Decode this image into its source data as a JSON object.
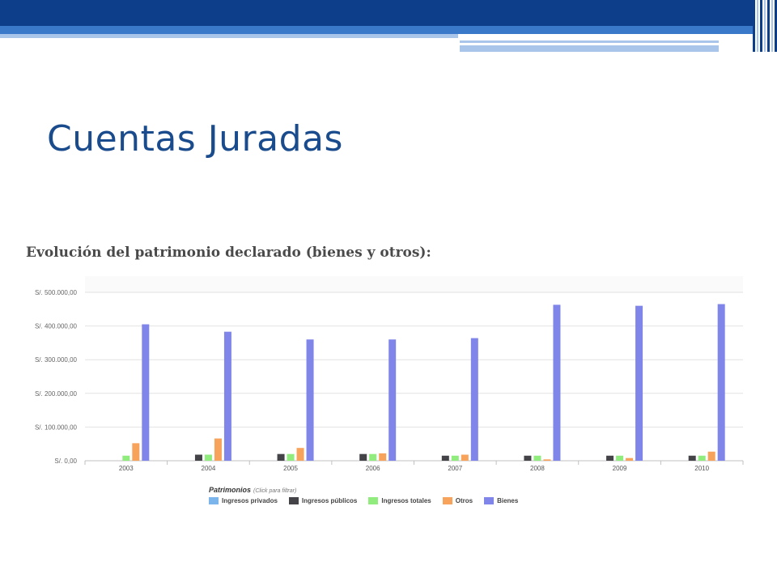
{
  "slide": {
    "title": "Cuentas Juradas",
    "chart_heading": "Evolución del patrimonio declarado (bienes y otros):"
  },
  "colors": {
    "header_dark": "#0d3e8a",
    "header_mid": "#3a78c9",
    "header_light": "#a9c6ea",
    "title_text": "#1a4b8c"
  },
  "legend": {
    "title": "Patrimonios",
    "hint": "(Click para filtrar)"
  },
  "chart_data": {
    "type": "bar",
    "categories": [
      "2003",
      "2004",
      "2005",
      "2006",
      "2007",
      "2008",
      "2009",
      "2010"
    ],
    "ylim": [
      0,
      500000
    ],
    "yticks": [
      0,
      100000,
      200000,
      300000,
      400000,
      500000
    ],
    "ytick_labels": [
      "S/. 0,00",
      "S/. 100.000,00",
      "S/. 200.000,00",
      "S/. 300.000,00",
      "S/. 400.000,00",
      "S/. 500.000,00"
    ],
    "grid": true,
    "legend_position": "bottom",
    "series": [
      {
        "name": "Ingresos privados",
        "color": "#7cb5ec",
        "values": [
          0,
          0,
          0,
          0,
          0,
          0,
          0,
          0
        ]
      },
      {
        "name": "Ingresos públicos",
        "color": "#434348",
        "values": [
          0,
          18000,
          20000,
          20000,
          15000,
          15000,
          15000,
          15000
        ]
      },
      {
        "name": "Ingresos totales",
        "color": "#90ed7d",
        "values": [
          15000,
          18000,
          20000,
          20000,
          15000,
          15000,
          15000,
          15000
        ]
      },
      {
        "name": "Otros",
        "color": "#f7a35c",
        "values": [
          52000,
          66000,
          38000,
          22000,
          18000,
          4000,
          8000,
          27000
        ]
      },
      {
        "name": "Bienes",
        "color": "#8085e9",
        "values": [
          405000,
          383000,
          360000,
          360000,
          364000,
          463000,
          460000,
          465000
        ]
      }
    ]
  }
}
